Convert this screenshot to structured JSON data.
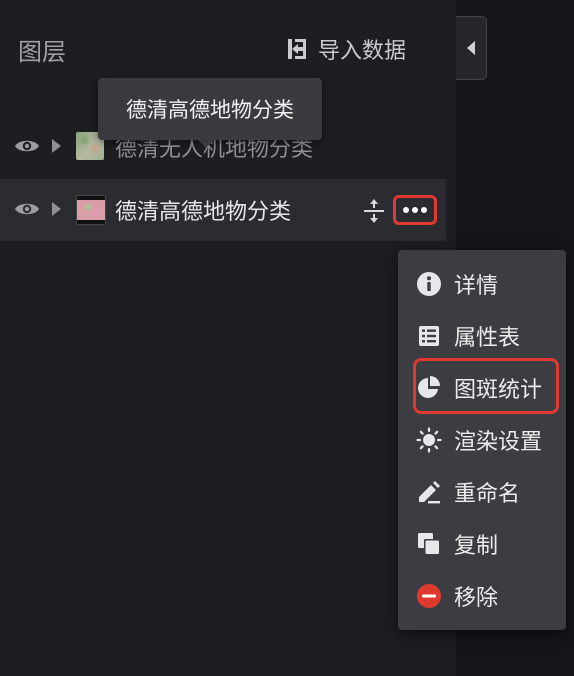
{
  "header": {
    "title": "图层",
    "import_label": "导入数据"
  },
  "tooltip": {
    "text": "德清高德地物分类"
  },
  "layers": [
    {
      "name": "德清无人机地物分类",
      "thumb_icon": "raster-thumbnail"
    },
    {
      "name": "德清高德地物分类",
      "thumb_icon": "raster-thumbnail"
    }
  ],
  "context_menu": {
    "items": [
      {
        "label": "详情",
        "icon": "info-icon"
      },
      {
        "label": "属性表",
        "icon": "table-icon"
      },
      {
        "label": "图斑统计",
        "icon": "pie-chart-icon"
      },
      {
        "label": "渲染设置",
        "icon": "sun-icon"
      },
      {
        "label": "重命名",
        "icon": "edit-icon"
      },
      {
        "label": "复制",
        "icon": "copy-icon"
      },
      {
        "label": "移除",
        "icon": "remove-icon"
      }
    ]
  },
  "colors": {
    "accent_red": "#e0392f",
    "panel_bg": "#1d1e22",
    "menu_bg": "#3b3d43"
  }
}
